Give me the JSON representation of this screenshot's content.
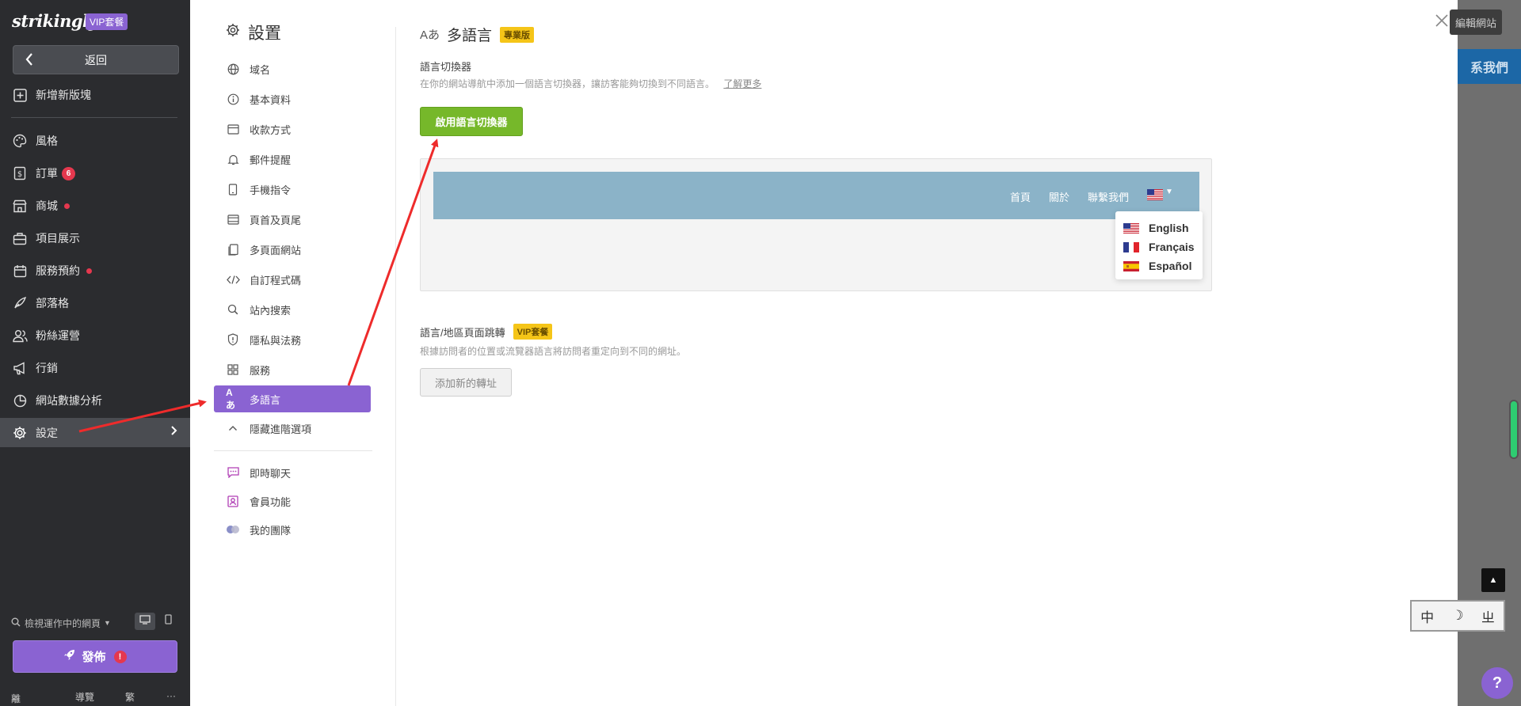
{
  "sidebar": {
    "logo": "strikingly",
    "vip_badge": "VIP套餐",
    "back_label": "返回",
    "add_section_label": "新增新版塊",
    "items": [
      {
        "label": "風格",
        "icon": "palette-icon"
      },
      {
        "label": "訂單",
        "icon": "order-icon",
        "badge": "6"
      },
      {
        "label": "商城",
        "icon": "store-icon",
        "dot": true
      },
      {
        "label": "項目展示",
        "icon": "portfolio-icon"
      },
      {
        "label": "服務預約",
        "icon": "calendar-icon",
        "dot": true
      },
      {
        "label": "部落格",
        "icon": "blog-icon"
      },
      {
        "label": "粉絲運營",
        "icon": "audience-icon"
      },
      {
        "label": "行銷",
        "icon": "megaphone-icon"
      },
      {
        "label": "網站數據分析",
        "icon": "analytics-icon"
      },
      {
        "label": "設定",
        "icon": "gear-icon",
        "active": true
      }
    ],
    "preview_label": "檢視運作中的網頁",
    "publish_label": "發佈",
    "publish_alert": "!",
    "footer": {
      "exit": "離開",
      "guide": "導覽",
      "lang": "繁",
      "more": "···"
    }
  },
  "settings": {
    "title": "設置",
    "menu": [
      {
        "label": "域名",
        "icon": "globe-icon"
      },
      {
        "label": "基本資料",
        "icon": "info-icon"
      },
      {
        "label": "收款方式",
        "icon": "card-icon"
      },
      {
        "label": "郵件提醒",
        "icon": "bell-icon"
      },
      {
        "label": "手機指令",
        "icon": "phone-icon"
      },
      {
        "label": "頁首及頁尾",
        "icon": "header-footer-icon"
      },
      {
        "label": "多頁面網站",
        "icon": "pages-icon"
      },
      {
        "label": "自訂程式碼",
        "icon": "code-icon"
      },
      {
        "label": "站內搜索",
        "icon": "search-icon"
      },
      {
        "label": "隱私與法務",
        "icon": "shield-icon"
      },
      {
        "label": "服務",
        "icon": "grid-icon"
      },
      {
        "label": "多語言",
        "icon": "translate-icon",
        "active": true
      },
      {
        "label": "隱藏進階選項",
        "icon": "chevron-up-icon"
      }
    ],
    "extra_menu": [
      {
        "label": "即時聊天",
        "icon": "chat-icon"
      },
      {
        "label": "會員功能",
        "icon": "member-icon"
      },
      {
        "label": "我的團隊",
        "icon": "team-icon"
      }
    ]
  },
  "content": {
    "title": "多語言",
    "title_icon_text": "Aあ",
    "pro_badge": "專業版",
    "switcher_label": "語言切換器",
    "switcher_desc": "在你的網站導航中添加一個語言切換器，讓訪客能夠切換到不同語言。",
    "learn_more": "了解更多",
    "enable_button": "啟用語言切換器",
    "preview_nav": [
      "首頁",
      "關於",
      "聯繫我們"
    ],
    "languages": [
      "English",
      "Français",
      "Español"
    ],
    "redirect_title": "語言/地區頁面跳轉",
    "vip_badge": "VIP套餐",
    "redirect_desc": "根據訪問者的位置或流覽器語言將訪問者重定向到不同的網址。",
    "add_redirect_button": "添加新的轉址"
  },
  "background": {
    "top_button": "編輯網站",
    "contact_text": "系我們",
    "ime": [
      "中",
      "☽",
      "ㄓ"
    ]
  },
  "colors": {
    "accent_purple": "#8a63d2",
    "enable_green": "#76b82a",
    "sidebar_dark": "#2b2c2f",
    "badge_yellow": "#f5c518",
    "annotation_red": "#ee2b2b"
  }
}
